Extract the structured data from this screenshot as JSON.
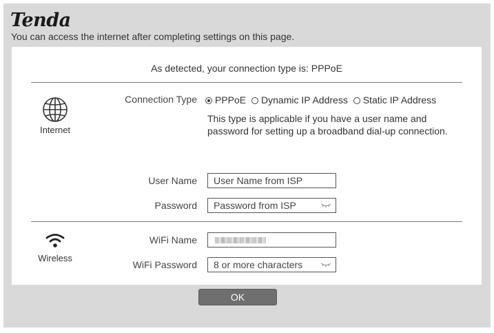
{
  "header": {
    "logo": "Tenda",
    "subtitle": "You can access the internet after completing settings on this page."
  },
  "detection": {
    "message": "As detected, your connection type is: PPPoE"
  },
  "internet": {
    "section_label": "Internet",
    "section_icon": "globe-icon",
    "connection_type_label": "Connection Type",
    "options": [
      {
        "label": "PPPoE",
        "selected": true
      },
      {
        "label": "Dynamic IP Address",
        "selected": false
      },
      {
        "label": "Static IP Address",
        "selected": false
      }
    ],
    "description": "This type is applicable if you have a user name and password for setting up a broadband dial-up connection.",
    "username": {
      "label": "User Name",
      "placeholder": "User Name from ISP",
      "value": ""
    },
    "password": {
      "label": "Password",
      "placeholder": "Password from ISP",
      "value": ""
    }
  },
  "wireless": {
    "section_label": "Wireless",
    "section_icon": "wifi-icon",
    "wifi_name": {
      "label": "WiFi Name",
      "value_obscured": true
    },
    "wifi_password": {
      "label": "WiFi Password",
      "placeholder": "8 or more characters",
      "value": ""
    }
  },
  "actions": {
    "ok_label": "OK"
  },
  "colors": {
    "frame_bg": "#d9d9d9",
    "panel_bg": "#ffffff",
    "button_bg": "#6f6f6f",
    "divider": "#7a7a7a"
  }
}
